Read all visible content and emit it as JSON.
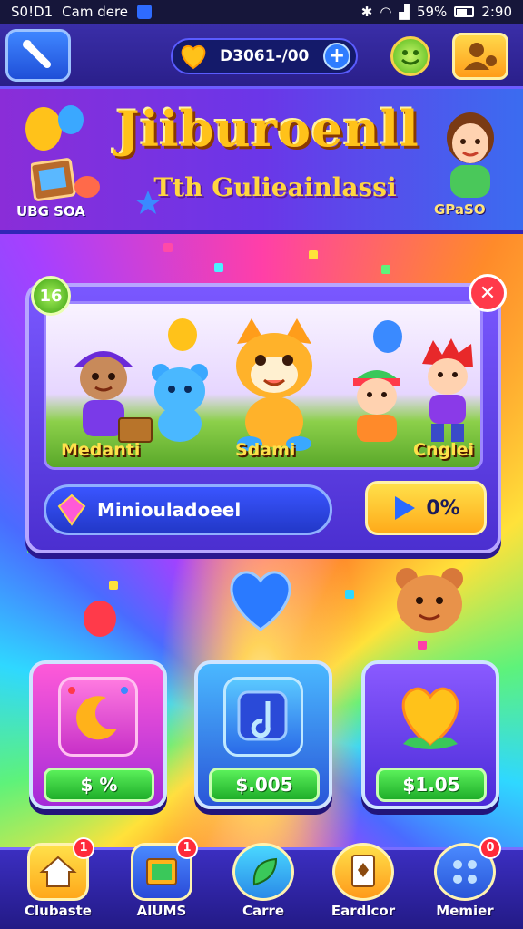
{
  "status_bar": {
    "left_text": "S0!D1",
    "app_text": "Cam dere",
    "battery": "59%",
    "time": "2:90"
  },
  "top_bar": {
    "coins": "D3061-/00"
  },
  "header": {
    "title": "Jiiburoenll",
    "subtitle": "Tth Gulieainlassi",
    "left_label": "UBG SOA",
    "right_label": "GPaSO"
  },
  "reward_panel": {
    "level": "16",
    "close_symbol": "✕",
    "characters": [
      {
        "label": "Medanti"
      },
      {
        "label": "Sdami"
      },
      {
        "label": "Cnglei"
      }
    ],
    "mission_label": "Miniouladoeel",
    "play_label": "0%"
  },
  "shop": {
    "items": [
      {
        "price": "$ %"
      },
      {
        "price": "$.005"
      },
      {
        "price": "$1.05"
      }
    ]
  },
  "bottom_nav": {
    "items": [
      {
        "label": "Clubaste",
        "badge": "1"
      },
      {
        "label": "AlUMS",
        "badge": "1"
      },
      {
        "label": "Carre",
        "badge": ""
      },
      {
        "label": "Eardlcor",
        "badge": ""
      },
      {
        "label": "Memier",
        "badge": "0"
      }
    ]
  },
  "colors": {
    "accent_blue": "#2f7dff",
    "gold": "#ffc21a",
    "green": "#1fae2a",
    "panel_purple": "#4b2fd0",
    "badge_red": "#ff2a3a"
  }
}
